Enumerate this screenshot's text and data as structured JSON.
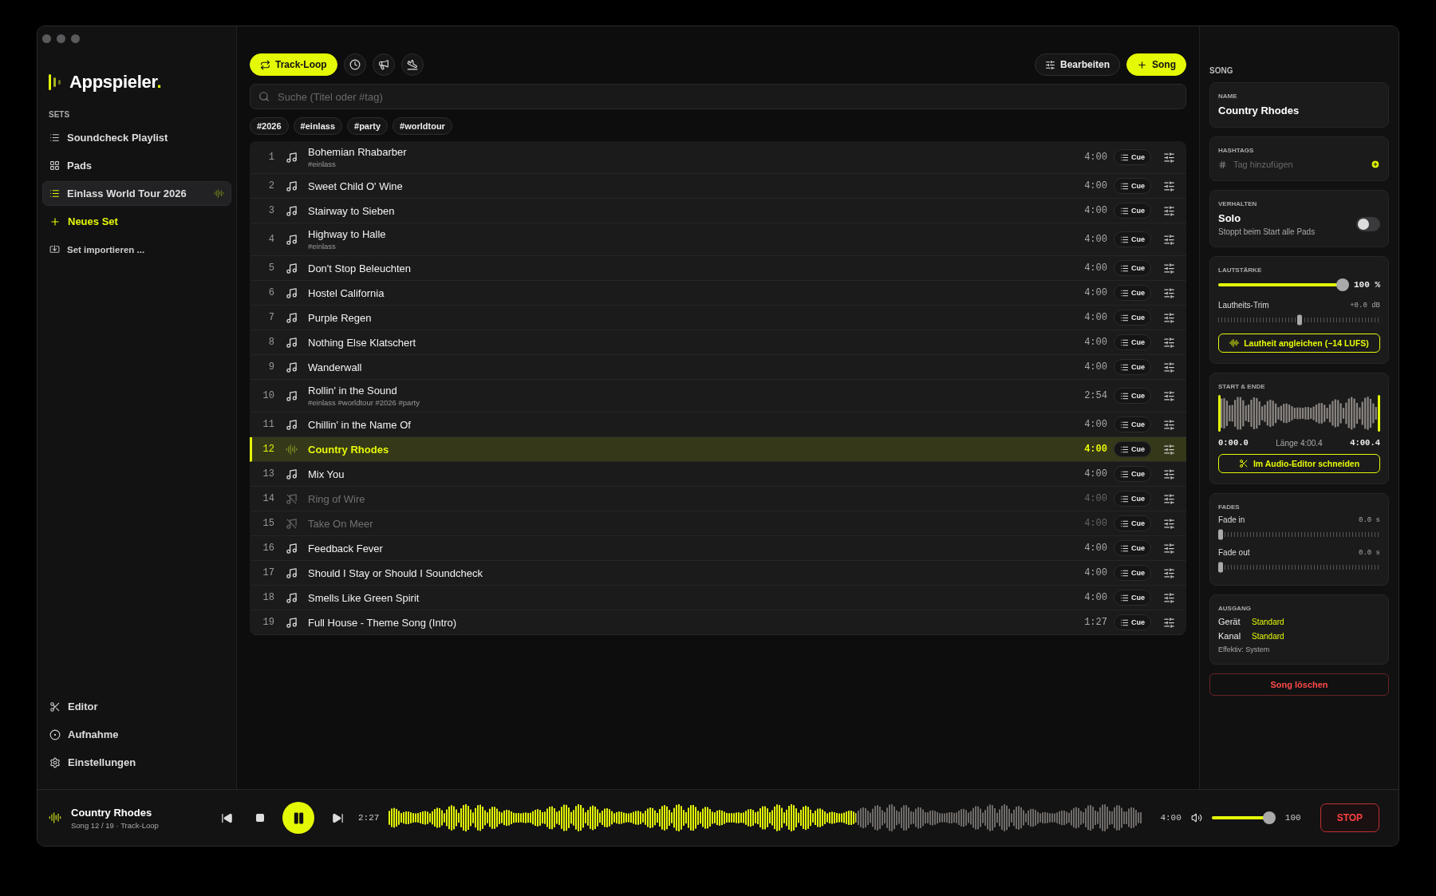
{
  "sidebar": {
    "logo": {
      "name": "Appspieler",
      "suffix": "."
    },
    "section_label": "SETS",
    "sets": [
      {
        "label": "Soundcheck Playlist",
        "kind": "list",
        "selected": false,
        "playing": false
      },
      {
        "label": "Pads",
        "kind": "pads",
        "selected": false,
        "playing": false
      },
      {
        "label": "Einlass World Tour 2026",
        "kind": "list",
        "selected": true,
        "playing": true
      }
    ],
    "new_set": "Neues Set",
    "import_set": "Set importieren ...",
    "bottom_items": [
      {
        "label": "Editor",
        "kind": "editor"
      },
      {
        "label": "Aufnahme",
        "kind": "record"
      },
      {
        "label": "Einstellungen",
        "kind": "settings"
      }
    ]
  },
  "toolbar": {
    "loop": {
      "label": "Track-Loop",
      "on": true
    },
    "icon_buttons": [
      {
        "kind": "clock"
      },
      {
        "kind": "announce"
      },
      {
        "kind": "landing"
      }
    ],
    "edit": "Bearbeiten",
    "add_song": "Song"
  },
  "search": {
    "placeholder": "Suche (Titel oder #tag)"
  },
  "tag_filters": [
    "#2026",
    "#einlass",
    "#party",
    "#worldtour"
  ],
  "songs": [
    {
      "number": "1",
      "title": "Bohemian Rhabarber",
      "tags": "#einlass",
      "duration": "4:00",
      "cue": "Cue",
      "selected": false,
      "muted": false
    },
    {
      "number": "2",
      "title": "Sweet Child O' Wine",
      "duration": "4:00",
      "cue": "Cue",
      "selected": false,
      "muted": false
    },
    {
      "number": "3",
      "title": "Stairway to Sieben",
      "duration": "4:00",
      "cue": "Cue",
      "selected": false,
      "muted": false
    },
    {
      "number": "4",
      "title": "Highway to Halle",
      "tags": "#einlass",
      "duration": "4:00",
      "cue": "Cue",
      "selected": false,
      "muted": false
    },
    {
      "number": "5",
      "title": "Don't Stop Beleuchten",
      "duration": "4:00",
      "cue": "Cue",
      "selected": false,
      "muted": false
    },
    {
      "number": "6",
      "title": "Hostel California",
      "duration": "4:00",
      "cue": "Cue",
      "selected": false,
      "muted": false
    },
    {
      "number": "7",
      "title": "Purple Regen",
      "duration": "4:00",
      "cue": "Cue",
      "selected": false,
      "muted": false
    },
    {
      "number": "8",
      "title": "Nothing Else Klatschert",
      "duration": "4:00",
      "cue": "Cue",
      "selected": false,
      "muted": false
    },
    {
      "number": "9",
      "title": "Wanderwall",
      "duration": "4:00",
      "cue": "Cue",
      "selected": false,
      "muted": false
    },
    {
      "number": "10",
      "title": "Rollin' in the Sound",
      "tags": "#einlass #worldtour #2026 #party",
      "duration": "2:54",
      "cue": "Cue",
      "selected": false,
      "muted": false
    },
    {
      "number": "11",
      "title": "Chillin' in the Name Of",
      "duration": "4:00",
      "cue": "Cue",
      "selected": false,
      "muted": false
    },
    {
      "number": "12",
      "title": "Country Rhodes",
      "duration": "4:00",
      "cue": "Cue",
      "selected": true,
      "muted": false
    },
    {
      "number": "13",
      "title": "Mix You",
      "duration": "4:00",
      "cue": "Cue",
      "selected": false,
      "muted": false
    },
    {
      "number": "14",
      "title": "Ring of Wire",
      "duration": "4:00",
      "cue": "Cue",
      "selected": false,
      "muted": true
    },
    {
      "number": "15",
      "title": "Take On Meer",
      "duration": "4:00",
      "cue": "Cue",
      "selected": false,
      "muted": true
    },
    {
      "number": "16",
      "title": "Feedback Fever",
      "duration": "4:00",
      "cue": "Cue",
      "selected": false,
      "muted": false
    },
    {
      "number": "17",
      "title": "Should I Stay or Should I Soundcheck",
      "duration": "4:00",
      "cue": "Cue",
      "selected": false,
      "muted": false
    },
    {
      "number": "18",
      "title": "Smells Like Green Spirit",
      "duration": "4:00",
      "cue": "Cue",
      "selected": false,
      "muted": false
    },
    {
      "number": "19",
      "title": "Full House - Theme Song (Intro)",
      "duration": "1:27",
      "cue": "Cue",
      "selected": false,
      "muted": false
    }
  ],
  "detail": {
    "heading": "SONG",
    "name": {
      "label": "NAME",
      "value": "Country Rhodes"
    },
    "hashtags": {
      "label": "HASHTAGS",
      "placeholder": "Tag hinzufügen"
    },
    "behavior": {
      "label": "VERHALTEN",
      "title": "Solo",
      "description": "Stoppt beim Start alle Pads",
      "on": false
    },
    "volume": {
      "label": "LAUTSTÄRKE",
      "level": 1,
      "reading": "100 %",
      "trim": {
        "label": "Lautheits-Trim",
        "reading": "+0.0 dB",
        "level": 0.5
      },
      "normalize": "Lautheit angleichen (−14 LUFS)"
    },
    "range": {
      "label": "START & ENDE",
      "start": "0:00.0",
      "length": "Länge 4:00.4",
      "end": "4:00.4",
      "button": "Im Audio-Editor schneiden"
    },
    "fades": {
      "label": "FADES",
      "items": [
        {
          "label": "Fade in",
          "reading": "0.0 s",
          "level": 0
        },
        {
          "label": "Fade out",
          "reading": "0.0 s",
          "level": 0
        }
      ]
    },
    "output": {
      "label": "AUSGANG",
      "rows": [
        {
          "label": "Gerät",
          "value": "Standard"
        },
        {
          "label": "Kanal",
          "value": "Standard"
        }
      ],
      "effective": "Effektiv: System"
    },
    "delete": "Song löschen"
  },
  "player": {
    "title": "Country Rhodes",
    "subtitle": "Song 12 / 19 · Track-Loop",
    "playing": true,
    "elapsed": "2:27",
    "total": "4:00",
    "volume": {
      "level": 1,
      "reading": "100"
    },
    "stop": "STOP"
  }
}
